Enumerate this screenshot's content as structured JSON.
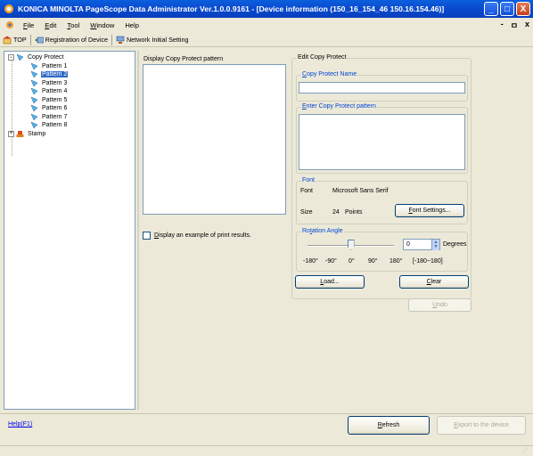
{
  "window": {
    "title": "KONICA MINOLTA PageScope Data Administrator Ver.1.0.0.9161 - [Device information (150_16_154_46 150.16.154.46)]",
    "minimize_glyph": "_",
    "maximize_glyph": "□",
    "close_glyph": "X"
  },
  "menu": {
    "items": [
      {
        "underline": "F",
        "rest": "ile"
      },
      {
        "underline": "E",
        "rest": "dit"
      },
      {
        "underline": "T",
        "rest": "ool"
      },
      {
        "underline": "W",
        "rest": "indow"
      },
      {
        "underline": "",
        "rest": "Help"
      }
    ],
    "mdi_minimize": "-",
    "mdi_restore": "ㅁ",
    "mdi_close": "x"
  },
  "toolbar": {
    "top_label": "TOP",
    "registration_label": "Registration of Device",
    "network_label": "Network Initial Setting"
  },
  "tree": {
    "root_label": "Copy Protect",
    "children": [
      "Pattern 1",
      "Pattern 2",
      "Pattern 3",
      "Pattern 4",
      "Pattern 5",
      "Pattern 6",
      "Pattern 7",
      "Pattern 8"
    ],
    "selected_index": 1,
    "stamp_label": "Stamp",
    "expand_minus": "−",
    "expand_plus": "+"
  },
  "pattern_display": {
    "caption": "Display Copy Protect pattern",
    "display_example_u": "D",
    "display_example_rest": "isplay an example of print results."
  },
  "edit": {
    "group_label": "Edit Copy Protect",
    "name_group_u": "C",
    "name_group_rest": "opy Protect Name",
    "name_value": "",
    "pattern_group_u": "E",
    "pattern_group_rest": "nter Copy Protect pattern",
    "pattern_value": "",
    "font_group": "Font",
    "font_label": "Font",
    "font_value": "Microsoft Sans Serif",
    "size_label": "Size",
    "size_value": "24",
    "size_unit": "Points",
    "font_settings_u": "F",
    "font_settings_rest": "ont Settings...",
    "rotation_group_pre": "Ro",
    "rotation_group_u": "t",
    "rotation_group_rest": "ation Angle",
    "angle_value": "0",
    "angle_unit": "Degrees",
    "scale_labels": [
      "-180°",
      "-90°",
      "0°",
      "90°",
      "180°"
    ],
    "range_label": "[-180~180]",
    "slider_fraction": 0.5,
    "load_u": "L",
    "load_rest": "oad...",
    "clear_u": "C",
    "clear_rest": "lear",
    "undo_u": "U",
    "undo_rest": "ndo"
  },
  "footer": {
    "help_label": "Help(F1)",
    "refresh_u": "R",
    "refresh_rest": "efresh",
    "export_u": "E",
    "export_rest": "xport to the device"
  },
  "colors": {
    "title_blue": "#0a4bd0",
    "selection": "#316ac5",
    "link": "#0000ee"
  }
}
